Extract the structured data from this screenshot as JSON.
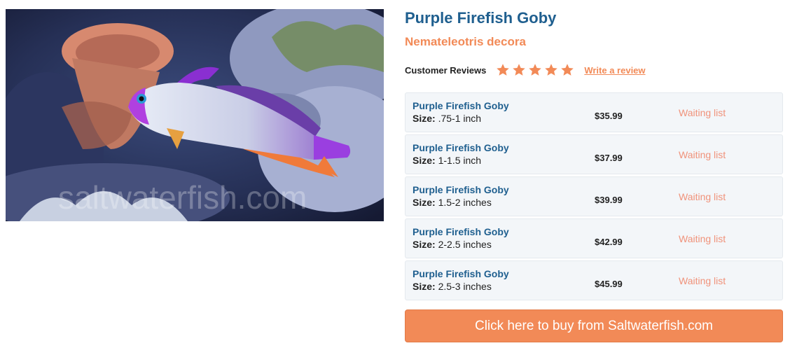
{
  "product": {
    "title": "Purple Firefish Goby",
    "scientific_name": "Nemateleotris decora",
    "image": {
      "watermark": "saltwaterfish.com"
    }
  },
  "reviews": {
    "label": "Customer Reviews",
    "rating": 5,
    "max_rating": 5,
    "star_icon": "star-icon",
    "write_link": "Write a review"
  },
  "size_label": "Size:",
  "variants": [
    {
      "name": "Purple Firefish Goby",
      "size": ".75-1 inch",
      "price": "$35.99",
      "status": "Waiting list"
    },
    {
      "name": "Purple Firefish Goby",
      "size": "1-1.5 inch",
      "price": "$37.99",
      "status": "Waiting list"
    },
    {
      "name": "Purple Firefish Goby",
      "size": "1.5-2 inches",
      "price": "$39.99",
      "status": "Waiting list"
    },
    {
      "name": "Purple Firefish Goby",
      "size": "2-2.5 inches",
      "price": "$42.99",
      "status": "Waiting list"
    },
    {
      "name": "Purple Firefish Goby",
      "size": "2.5-3 inches",
      "price": "$45.99",
      "status": "Waiting list"
    }
  ],
  "buy_button": "Click here to buy from Saltwaterfish.com",
  "colors": {
    "title": "#1f5f8f",
    "accent": "#f28a57",
    "status": "#f0927a",
    "row_bg": "#f3f6f9"
  }
}
